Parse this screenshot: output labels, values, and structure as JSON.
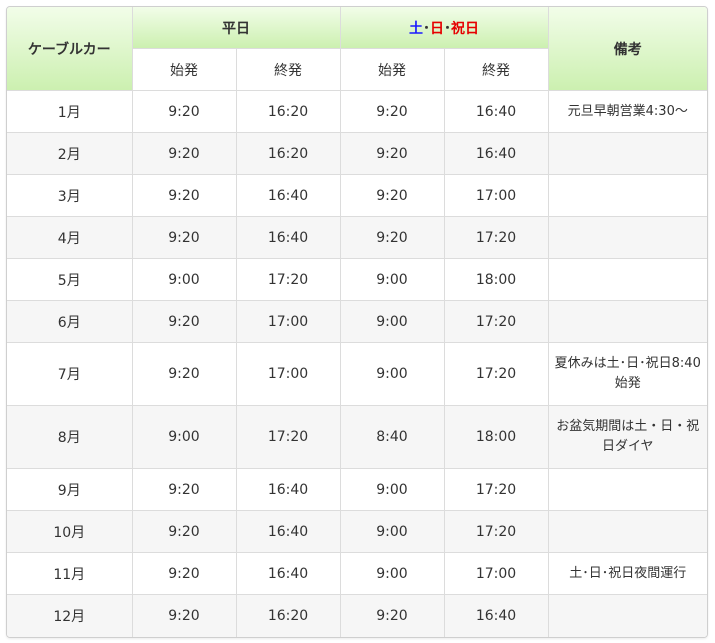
{
  "headers": {
    "corner": "ケーブルカー",
    "weekday": "平日",
    "weekend": {
      "sat": "土",
      "dot1": "･",
      "sun": "日",
      "dot2": "･",
      "hol": "祝日"
    },
    "notes": "備考",
    "sub": [
      "始発",
      "終発",
      "始発",
      "終発"
    ]
  },
  "rows": [
    {
      "month": "1月",
      "wd_first": "9:20",
      "wd_last": "16:20",
      "we_first": "9:20",
      "we_last": "16:40",
      "note": "元旦早朝営業4:30～"
    },
    {
      "month": "2月",
      "wd_first": "9:20",
      "wd_last": "16:20",
      "we_first": "9:20",
      "we_last": "16:40",
      "note": ""
    },
    {
      "month": "3月",
      "wd_first": "9:20",
      "wd_last": "16:40",
      "we_first": "9:20",
      "we_last": "17:00",
      "note": ""
    },
    {
      "month": "4月",
      "wd_first": "9:20",
      "wd_last": "16:40",
      "we_first": "9:20",
      "we_last": "17:20",
      "note": ""
    },
    {
      "month": "5月",
      "wd_first": "9:00",
      "wd_last": "17:20",
      "we_first": "9:00",
      "we_last": "18:00",
      "note": ""
    },
    {
      "month": "6月",
      "wd_first": "9:20",
      "wd_last": "17:00",
      "we_first": "9:00",
      "we_last": "17:20",
      "note": ""
    },
    {
      "month": "7月",
      "wd_first": "9:20",
      "wd_last": "17:00",
      "we_first": "9:00",
      "we_last": "17:20",
      "note": "夏休みは土･日･祝日8:40始発"
    },
    {
      "month": "8月",
      "wd_first": "9:00",
      "wd_last": "17:20",
      "we_first": "8:40",
      "we_last": "18:00",
      "note": "お盆気期間は土・日・祝日ダイヤ"
    },
    {
      "month": "9月",
      "wd_first": "9:20",
      "wd_last": "16:40",
      "we_first": "9:00",
      "we_last": "17:20",
      "note": ""
    },
    {
      "month": "10月",
      "wd_first": "9:20",
      "wd_last": "16:40",
      "we_first": "9:00",
      "we_last": "17:20",
      "note": ""
    },
    {
      "month": "11月",
      "wd_first": "9:20",
      "wd_last": "16:40",
      "we_first": "9:00",
      "we_last": "17:00",
      "note": "土･日･祝日夜間運行"
    },
    {
      "month": "12月",
      "wd_first": "9:20",
      "wd_last": "16:20",
      "we_first": "9:20",
      "we_last": "16:40",
      "note": ""
    }
  ],
  "colors": {
    "header_gradient_top": "#f2fde9",
    "header_gradient_bottom": "#ccf0b0",
    "saturday": "#1a1aff",
    "sunday_holiday": "#e60000",
    "stripe": "#f6f6f6"
  }
}
